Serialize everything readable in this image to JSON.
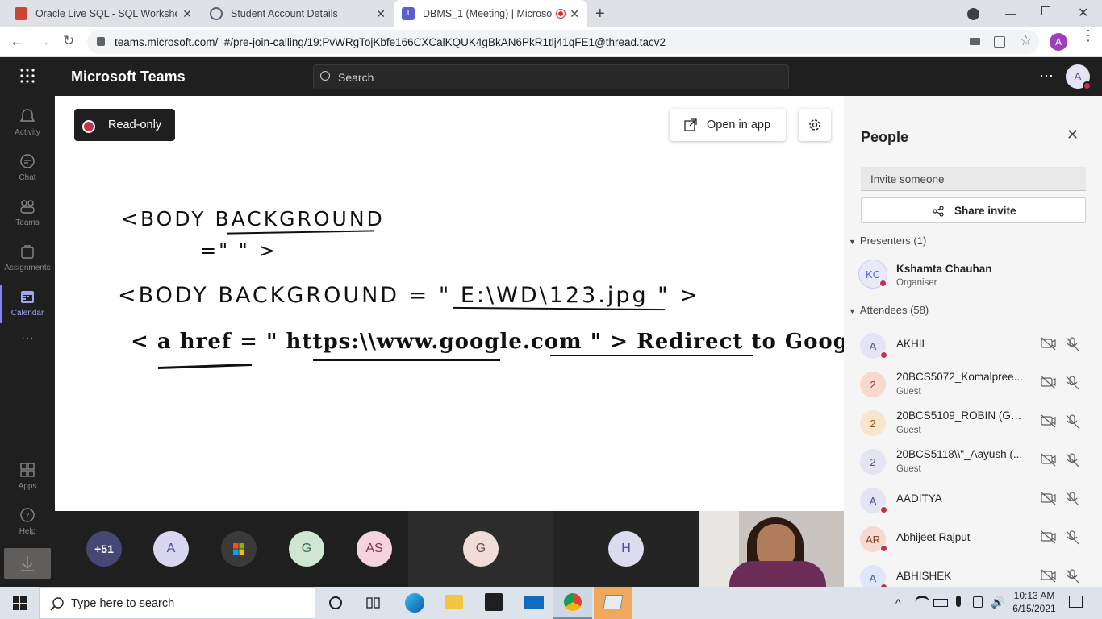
{
  "browser": {
    "tabs": [
      {
        "title": "Oracle Live SQL - SQL Worksheet",
        "icon": "oracle-icon",
        "active": false
      },
      {
        "title": "Student Account Details",
        "icon": "globe-icon",
        "active": false
      },
      {
        "title": "DBMS_1 (Meeting) | Microso",
        "icon": "teams-icon",
        "active": true
      }
    ],
    "url": "teams.microsoft.com/_#/pre-join-calling/19:PvWRgTojKbfe166CXCalKQUK4gBkAN6PkR1tlj41qFE1@thread.tacv2",
    "profile_initial": "A",
    "colors": {
      "profile": "#9c3fbf",
      "recording": "#d93025"
    }
  },
  "teams": {
    "app_title": "Microsoft Teams",
    "search_placeholder": "Search",
    "user_initial": "A",
    "more_label": "···",
    "rail": [
      {
        "label": "Activity",
        "icon": "bell-icon"
      },
      {
        "label": "Chat",
        "icon": "chat-icon"
      },
      {
        "label": "Teams",
        "icon": "teams-people-icon"
      },
      {
        "label": "Assignments",
        "icon": "assignments-icon"
      },
      {
        "label": "Calendar",
        "icon": "calendar-icon"
      },
      {
        "label": "Apps",
        "icon": "apps-icon"
      },
      {
        "label": "Help",
        "icon": "help-icon"
      }
    ],
    "rail_more": "···"
  },
  "whiteboard": {
    "read_only_label": "Read-only",
    "open_in_app_label": "Open in app",
    "lines": [
      "<BODY BACKGROUND",
      "=\" \" >",
      "<BODY BACKGROUND = \" E:\\WD\\123.jpg \" >",
      "< a href = \" https:\\\\www.google.com \" > Redirect to Google </a >"
    ]
  },
  "video_strip": {
    "overflow_count": "+51",
    "tiles": [
      {
        "initials": "A",
        "color": "#d9d7f0",
        "text_color": "#4f4d8c"
      },
      {
        "initials": "",
        "color": "#3b3a39",
        "icon": "microsoft-logo-icon"
      },
      {
        "initials": "G",
        "color": "#cfe6d3",
        "text_color": "#3f6e46"
      },
      {
        "initials": "AS",
        "color": "#f6d3de",
        "text_color": "#8c3151"
      },
      {
        "initials": "G",
        "color": "#f1ddd7",
        "text_color": "#6e4a3f"
      },
      {
        "initials": "H",
        "color": "#dcdcf0",
        "text_color": "#4f4d8c"
      }
    ]
  },
  "people": {
    "title": "People",
    "invite_placeholder": "Invite someone",
    "share_invite_label": "Share invite",
    "presenters_header": "Presenters (1)",
    "attendees_header": "Attendees (58)",
    "presenters": [
      {
        "initials": "KC",
        "name": "Kshamta Chauhan",
        "sub": "Organiser",
        "color": "#e8ebf7",
        "text_color": "#4f6bed"
      }
    ],
    "attendees": [
      {
        "initials": "A",
        "name": "AKHIL",
        "sub": "",
        "color": "#e5e4f4",
        "text_color": "#4f4d8c"
      },
      {
        "initials": "2",
        "name": "20BCS5072_Komalpree...",
        "sub": "Guest",
        "color": "#f6d9cf",
        "text_color": "#8c3f24"
      },
      {
        "initials": "2",
        "name": "20BCS5109_ROBIN (Gu...",
        "sub": "Guest",
        "color": "#f8e6cc",
        "text_color": "#8c5a14"
      },
      {
        "initials": "2",
        "name": "20BCS5118\\\\\"_Aayush (...",
        "sub": "Guest",
        "color": "#e5e4f4",
        "text_color": "#4f4d8c"
      },
      {
        "initials": "A",
        "name": "AADITYA",
        "sub": "",
        "color": "#e5e4f4",
        "text_color": "#4f4d8c"
      },
      {
        "initials": "AR",
        "name": "Abhijeet Rajput",
        "sub": "",
        "color": "#f6d9cf",
        "text_color": "#8c3f24"
      },
      {
        "initials": "A",
        "name": "ABHISHEK",
        "sub": "",
        "color": "#dfe6f7",
        "text_color": "#3b5aa8"
      }
    ]
  },
  "taskbar": {
    "search_placeholder": "Type here to search",
    "time": "10:13 AM",
    "date": "6/15/2021"
  }
}
